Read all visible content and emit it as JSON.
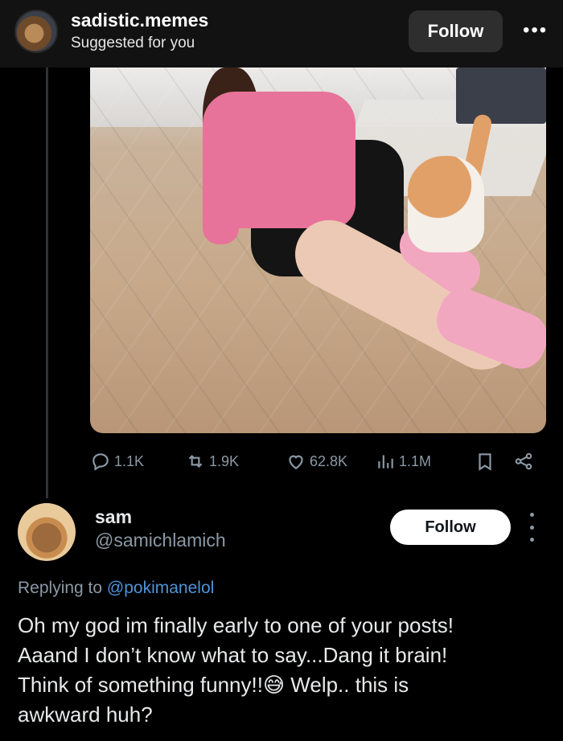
{
  "header": {
    "username": "sadistic.memes",
    "subtitle": "Suggested for you",
    "follow_label": "Follow",
    "more_label": "•••"
  },
  "stats": {
    "replies": "1.1K",
    "retweets": "1.9K",
    "likes": "62.8K",
    "views": "1.1M",
    "icons": [
      "reply-icon",
      "retweet-icon",
      "heart-icon",
      "views-icon",
      "bookmark-icon",
      "share-icon"
    ]
  },
  "reply": {
    "name": "sam",
    "handle": "@samichlamich",
    "follow_label": "Follow",
    "replying_prefix": "Replying to",
    "replying_mention": "@pokimanelol",
    "text_line1": "Oh my god im finally early to one of your posts!",
    "text_line2": "Aaand I don’t know what to say...Dang it brain!",
    "text_line3_a": "Think of something funny!!",
    "emoji": "😅",
    "text_line3_b": " Welp.. this is",
    "text_line4": "awkward huh?"
  },
  "colors": {
    "background": "#000000",
    "secondary_text": "#8b98a5",
    "mention": "#4f93d8",
    "follow_light_bg": "#ffffff",
    "follow_dark_bg": "#2e2e2e"
  }
}
